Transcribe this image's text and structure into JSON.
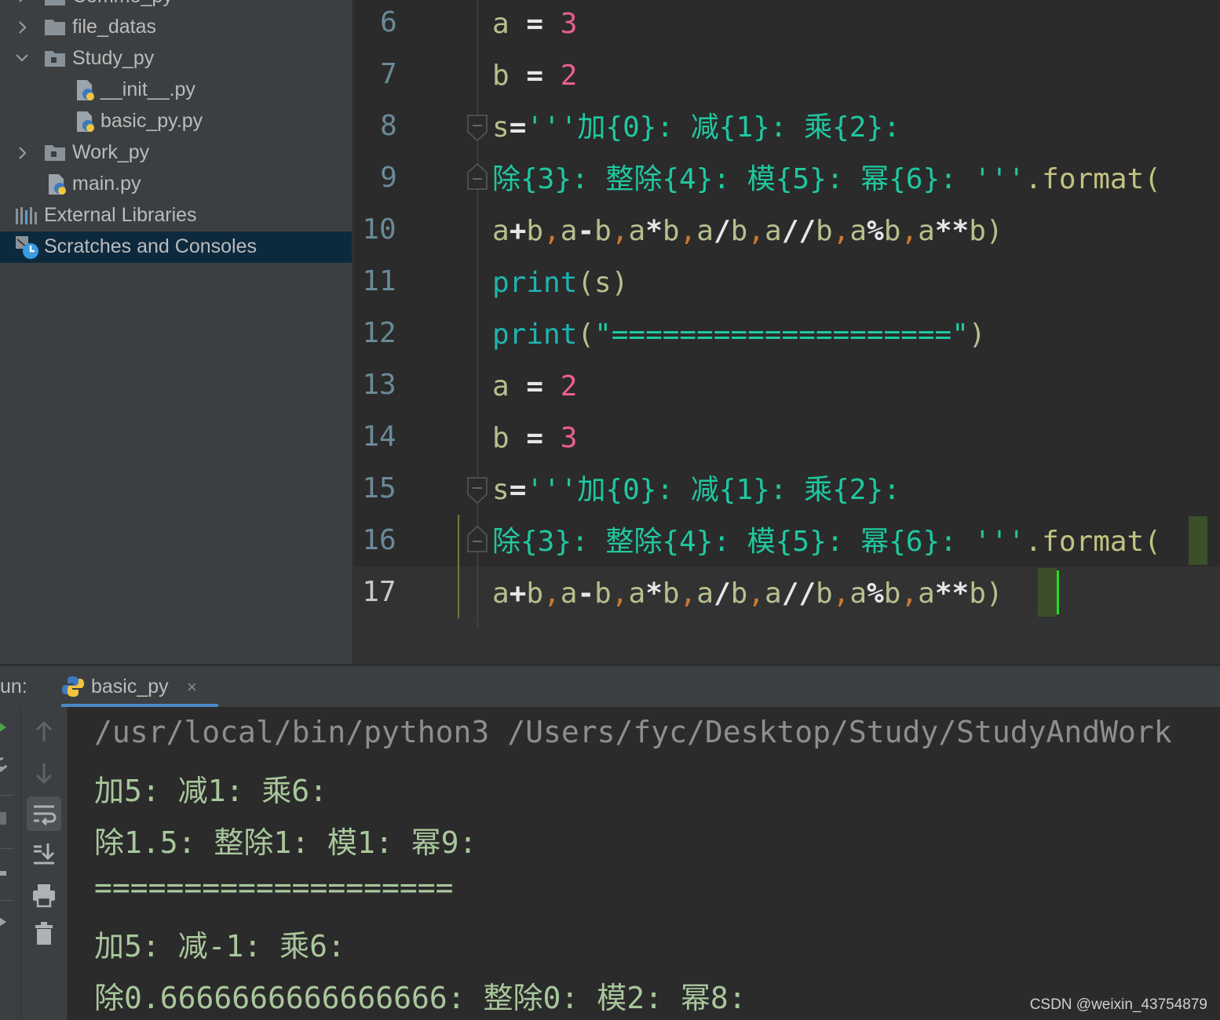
{
  "sidebar": {
    "items": [
      {
        "label": "Commo_py",
        "type": "folder",
        "expanded": false
      },
      {
        "label": "file_datas",
        "type": "folder",
        "expanded": false
      },
      {
        "label": "Study_py",
        "type": "package",
        "expanded": true
      },
      {
        "label": "__init__.py",
        "type": "python-file"
      },
      {
        "label": "basic_py.py",
        "type": "python-file"
      },
      {
        "label": "Work_py",
        "type": "package",
        "expanded": false
      },
      {
        "label": "main.py",
        "type": "python-file"
      },
      {
        "label": "External Libraries",
        "type": "libraries"
      },
      {
        "label": "Scratches and Consoles",
        "type": "scratches",
        "selected": true
      }
    ]
  },
  "editor": {
    "line_numbers": [
      "6",
      "7",
      "8",
      "9",
      "10",
      "11",
      "12",
      "13",
      "14",
      "15",
      "16",
      "17"
    ],
    "current_line": "17",
    "lines": [
      [
        {
          "t": "a",
          "c": "v"
        },
        {
          "t": " = ",
          "c": "op"
        },
        {
          "t": "3",
          "c": "num"
        }
      ],
      [
        {
          "t": "b",
          "c": "v"
        },
        {
          "t": " = ",
          "c": "op"
        },
        {
          "t": "2",
          "c": "num"
        }
      ],
      [
        {
          "t": "s",
          "c": "v"
        },
        {
          "t": "=",
          "c": "op"
        },
        {
          "t": "'''加{0}: 减{1}: 乘{2}:",
          "c": "str"
        }
      ],
      [
        {
          "t": "除{3}: 整除{4}: 模{5}: 幂{6}: '''",
          "c": "str"
        },
        {
          "t": ".format(",
          "c": "method"
        }
      ],
      [
        {
          "t": "a",
          "c": "v"
        },
        {
          "t": "+",
          "c": "op"
        },
        {
          "t": "b",
          "c": "v"
        },
        {
          "t": ",",
          "c": "comma"
        },
        {
          "t": "a",
          "c": "v"
        },
        {
          "t": "-",
          "c": "op"
        },
        {
          "t": "b",
          "c": "v"
        },
        {
          "t": ",",
          "c": "comma"
        },
        {
          "t": "a",
          "c": "v"
        },
        {
          "t": "*",
          "c": "op"
        },
        {
          "t": "b",
          "c": "v"
        },
        {
          "t": ",",
          "c": "comma"
        },
        {
          "t": "a",
          "c": "v"
        },
        {
          "t": "/",
          "c": "op"
        },
        {
          "t": "b",
          "c": "v"
        },
        {
          "t": ",",
          "c": "comma"
        },
        {
          "t": "a",
          "c": "v"
        },
        {
          "t": "//",
          "c": "op"
        },
        {
          "t": "b",
          "c": "v"
        },
        {
          "t": ",",
          "c": "comma"
        },
        {
          "t": "a",
          "c": "v"
        },
        {
          "t": "%",
          "c": "op"
        },
        {
          "t": "b",
          "c": "v"
        },
        {
          "t": ",",
          "c": "comma"
        },
        {
          "t": "a",
          "c": "v"
        },
        {
          "t": "**",
          "c": "op"
        },
        {
          "t": "b)",
          "c": "p"
        }
      ],
      [
        {
          "t": "print",
          "c": "fn"
        },
        {
          "t": "(s)",
          "c": "p"
        }
      ],
      [
        {
          "t": "print",
          "c": "fn"
        },
        {
          "t": "(",
          "c": "p"
        },
        {
          "t": "\"====================\"",
          "c": "str"
        },
        {
          "t": ")",
          "c": "p"
        }
      ],
      [
        {
          "t": "a",
          "c": "v"
        },
        {
          "t": " = ",
          "c": "op"
        },
        {
          "t": "2",
          "c": "num"
        }
      ],
      [
        {
          "t": "b",
          "c": "v"
        },
        {
          "t": " = ",
          "c": "op"
        },
        {
          "t": "3",
          "c": "num"
        }
      ],
      [
        {
          "t": "s",
          "c": "v"
        },
        {
          "t": "=",
          "c": "op"
        },
        {
          "t": "'''加{0}: 减{1}: 乘{2}:",
          "c": "str"
        }
      ],
      [
        {
          "t": "除{3}: 整除{4}: 模{5}: 幂{6}: '''",
          "c": "str"
        },
        {
          "t": ".format(",
          "c": "method"
        }
      ],
      [
        {
          "t": "a",
          "c": "v"
        },
        {
          "t": "+",
          "c": "op"
        },
        {
          "t": "b",
          "c": "v"
        },
        {
          "t": ",",
          "c": "comma"
        },
        {
          "t": "a",
          "c": "v"
        },
        {
          "t": "-",
          "c": "op"
        },
        {
          "t": "b",
          "c": "v"
        },
        {
          "t": ",",
          "c": "comma"
        },
        {
          "t": "a",
          "c": "v"
        },
        {
          "t": "*",
          "c": "op"
        },
        {
          "t": "b",
          "c": "v"
        },
        {
          "t": ",",
          "c": "comma"
        },
        {
          "t": "a",
          "c": "v"
        },
        {
          "t": "/",
          "c": "op"
        },
        {
          "t": "b",
          "c": "v"
        },
        {
          "t": ",",
          "c": "comma"
        },
        {
          "t": "a",
          "c": "v"
        },
        {
          "t": "//",
          "c": "op"
        },
        {
          "t": "b",
          "c": "v"
        },
        {
          "t": ",",
          "c": "comma"
        },
        {
          "t": "a",
          "c": "v"
        },
        {
          "t": "%",
          "c": "op"
        },
        {
          "t": "b",
          "c": "v"
        },
        {
          "t": ",",
          "c": "comma"
        },
        {
          "t": "a",
          "c": "v"
        },
        {
          "t": "**",
          "c": "op"
        },
        {
          "t": "b)",
          "c": "p"
        }
      ]
    ]
  },
  "run": {
    "label": "un:",
    "tab_label": "basic_py",
    "tab_close": "×",
    "tools": [
      "rerun-icon",
      "stop-icon",
      "up-arrow-icon",
      "down-arrow-icon",
      "soft-wrap-icon",
      "scroll-to-end-icon",
      "print-icon",
      "trash-icon",
      "pin-icon"
    ]
  },
  "console": {
    "lines": [
      "/usr/local/bin/python3 /Users/fyc/Desktop/Study/StudyAndWork",
      "加5: 减1: 乘6:",
      "除1.5: 整除1: 模1: 幂9:",
      "====================",
      "加5: 减-1: 乘6:",
      "除0.6666666666666666: 整除0: 模2: 幂8:"
    ]
  },
  "watermark": "CSDN @weixin_43754879",
  "colors": {
    "sidebar_bg": "#3c3f41",
    "selected_row": "#0d293e",
    "editor_bg": "#2b2b2b",
    "string_green": "#1fc8a0",
    "number_pink": "#ec5f93",
    "caret_green": "#22dd22",
    "tab_underline": "#4a88c7"
  }
}
